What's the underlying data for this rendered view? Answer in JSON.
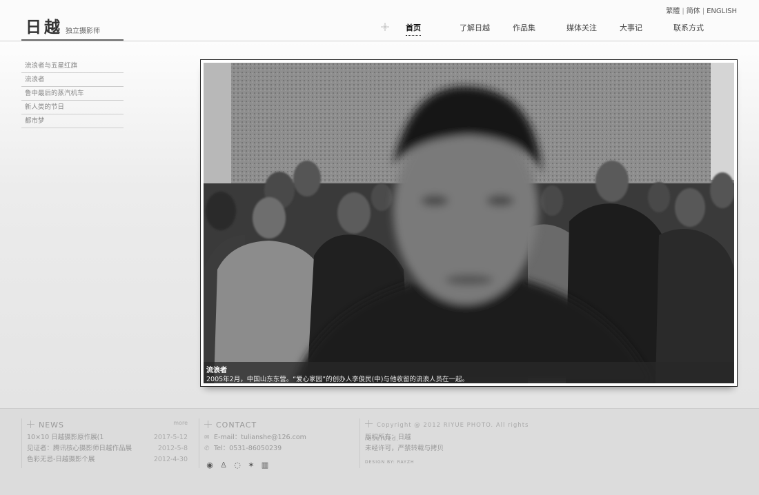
{
  "header": {
    "logo_main": "日越",
    "logo_sub": "独立摄影师",
    "lang": [
      "繁體",
      "简体",
      "ENGLISH"
    ],
    "nav": [
      "首页",
      "了解日越",
      "作品集",
      "媒体关注",
      "大事记",
      "联系方式"
    ],
    "active_nav": "首页"
  },
  "sidebar": {
    "items": [
      "流浪者与五星红旗",
      "流浪者",
      "鲁中最后的蒸汽机车",
      "新人类的节日",
      "都市梦"
    ]
  },
  "slide": {
    "title": "流浪者",
    "caption": "2005年2月，中国山东东营。“爱心家园”的创办人李俊民(中)与他收留的流浪人员在一起。"
  },
  "footer": {
    "news": {
      "title": "NEWS",
      "more": "more",
      "items": [
        {
          "title": "10×10 日越摄影原作展(1",
          "date": "2017-5-12"
        },
        {
          "title": "见证者：腾讯核心摄影师日越作品展",
          "date": "2012-5-8"
        },
        {
          "title": "色彩无忌-日越摄影个展",
          "date": "2012-4-30"
        }
      ]
    },
    "contact": {
      "title": "CONTACT",
      "email": "E-mail：tulianshe@126.com",
      "tel": "Tel：0531-86050239",
      "social": [
        "weibo-icon",
        "qq-icon",
        "chat-icon",
        "star-icon",
        "stats-icon"
      ]
    },
    "copyright": {
      "line": "Copyright @ 2012 RIYUE PHOTO. All rights reserved.",
      "owner": "版权所有：日越",
      "notice": "未经许可，严禁转载与拷贝",
      "design": "DESIGN BY: RAYZH"
    }
  }
}
